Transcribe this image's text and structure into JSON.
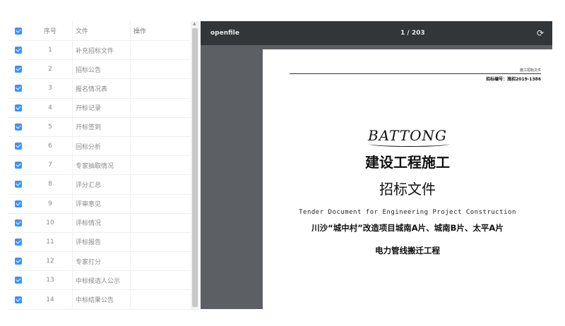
{
  "table": {
    "headers": {
      "index": "序号",
      "file": "文件",
      "operation": "操作"
    },
    "rows": [
      {
        "index": "1",
        "file": "补充招标文件"
      },
      {
        "index": "2",
        "file": "招标公告"
      },
      {
        "index": "3",
        "file": "报名情况表"
      },
      {
        "index": "4",
        "file": "开标记录"
      },
      {
        "index": "5",
        "file": "开标签到"
      },
      {
        "index": "6",
        "file": "回标分析"
      },
      {
        "index": "7",
        "file": "专家抽取情况"
      },
      {
        "index": "8",
        "file": "评分汇总"
      },
      {
        "index": "9",
        "file": "评审意见"
      },
      {
        "index": "10",
        "file": "评标情况"
      },
      {
        "index": "11",
        "file": "评标报告"
      },
      {
        "index": "12",
        "file": "专家打分"
      },
      {
        "index": "13",
        "file": "中标候选人公示"
      },
      {
        "index": "14",
        "file": "中标结果公告"
      }
    ],
    "checkbox_color": "#3d94f6"
  },
  "viewer": {
    "file_name": "openfile",
    "page_indicator": "1 / 203",
    "rotate_icon": "rotate-icon"
  },
  "document": {
    "header_small": "施工招标文件",
    "header_number": "招标编号：施招2019-1386",
    "logo_text": "BATTONG",
    "title_line1": "建设工程施工",
    "title_line2": "招标文件",
    "title_en": "Tender Document for Engineering Project Construction",
    "project_line1": "川沙“城中村”改造项目城南A片、城南B片、太平A片",
    "project_line2": "电力管线搬迁工程"
  }
}
